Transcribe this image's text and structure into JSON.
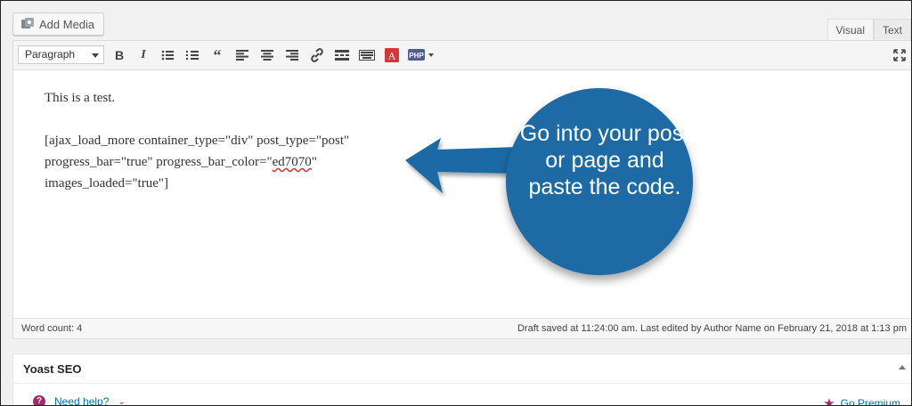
{
  "media": {
    "add_media_label": "Add Media"
  },
  "tabs": {
    "visual": "Visual",
    "text": "Text"
  },
  "toolbar": {
    "format_select": "Paragraph"
  },
  "content": {
    "line1": "This is a test.",
    "sc_line1": "[ajax_load_more container_type=\"div\" post_type=\"post\"",
    "sc_line2_a": "progress_bar=\"true\" progress_bar_color=\"",
    "sc_line2_spell": "ed7070",
    "sc_line2_b": "\"",
    "sc_line3": "images_loaded=\"true\"]"
  },
  "status": {
    "word_count": "Word count: 4",
    "draft": "Draft saved at 11:24:00 am. Last edited by Author Name on February 21, 2018 at 1:13 pm"
  },
  "yoast": {
    "title": "Yoast SEO",
    "need_help": "Need help?",
    "go_premium": "Go Premium"
  },
  "annotation": {
    "text": "Go into your post or page and paste the code.",
    "color": "#1d6aa5"
  },
  "colors": {
    "accent": "#0073aa",
    "yoast": "#a4286a"
  }
}
